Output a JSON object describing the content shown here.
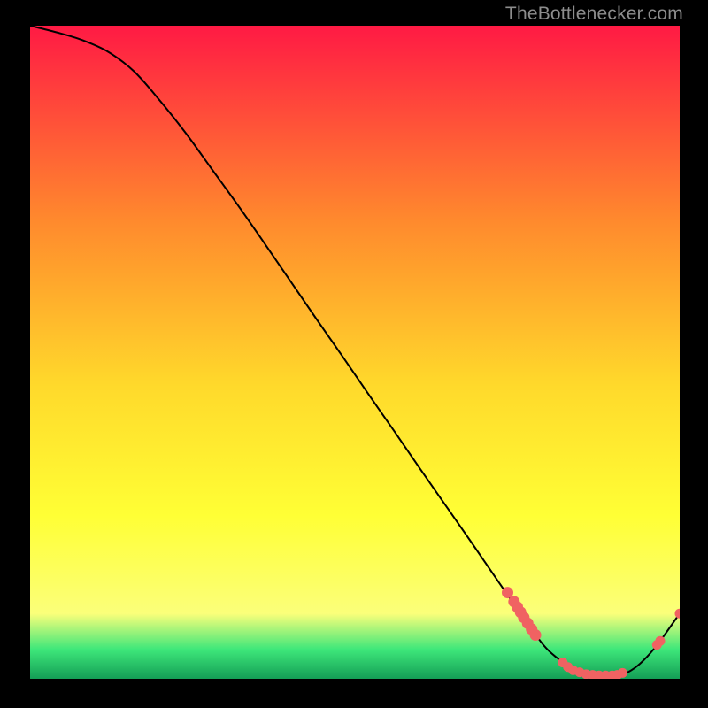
{
  "watermark": {
    "text": "TheBottlenecker.com"
  },
  "colors": {
    "curve": "#000000",
    "marker": "#f06262",
    "bg_top": "#ff1a44",
    "bg_mid1": "#ff8a2d",
    "bg_mid2": "#ffd92b",
    "bg_mid3": "#ffff35",
    "bg_yel": "#fbff7a",
    "bg_green": "#3ee77a",
    "bg_dkgreen": "#149e56"
  },
  "chart_data": {
    "type": "line",
    "title": "",
    "xlabel": "",
    "ylabel": "",
    "xlim": [
      0,
      100
    ],
    "ylim": [
      0,
      100
    ],
    "grid": false,
    "legend": false,
    "x": [
      0,
      4,
      8,
      12,
      16,
      20,
      24,
      28,
      32,
      36,
      40,
      44,
      48,
      52,
      56,
      60,
      64,
      68,
      72,
      76,
      79,
      81,
      83,
      85,
      87,
      89,
      91,
      93,
      95,
      97,
      100
    ],
    "values": [
      100,
      99,
      97.8,
      96,
      93,
      88.5,
      83.5,
      78,
      72.5,
      66.8,
      61,
      55.2,
      49.5,
      43.7,
      38,
      32.2,
      26.5,
      20.8,
      15,
      9.3,
      5.2,
      3.3,
      2.0,
      1.1,
      0.6,
      0.5,
      0.6,
      1.6,
      3.4,
      5.8,
      10
    ],
    "markers_upper": [
      {
        "x": 73.5,
        "y": 13.2
      },
      {
        "x": 74.5,
        "y": 11.8
      },
      {
        "x": 75.0,
        "y": 11.0
      },
      {
        "x": 75.5,
        "y": 10.2
      },
      {
        "x": 76.0,
        "y": 9.4
      },
      {
        "x": 76.6,
        "y": 8.5
      },
      {
        "x": 77.2,
        "y": 7.6
      },
      {
        "x": 77.8,
        "y": 6.7
      }
    ],
    "markers_lower": [
      {
        "x": 82.0,
        "y": 2.5
      },
      {
        "x": 82.8,
        "y": 1.8
      },
      {
        "x": 83.6,
        "y": 1.3
      },
      {
        "x": 84.6,
        "y": 1.0
      },
      {
        "x": 85.6,
        "y": 0.7
      },
      {
        "x": 86.6,
        "y": 0.6
      },
      {
        "x": 87.6,
        "y": 0.5
      },
      {
        "x": 88.6,
        "y": 0.5
      },
      {
        "x": 89.6,
        "y": 0.5
      },
      {
        "x": 90.4,
        "y": 0.6
      },
      {
        "x": 91.2,
        "y": 0.9
      }
    ],
    "markers_tail": [
      {
        "x": 96.5,
        "y": 5.2
      },
      {
        "x": 97.0,
        "y": 5.8
      },
      {
        "x": 100.0,
        "y": 10.0
      }
    ]
  }
}
